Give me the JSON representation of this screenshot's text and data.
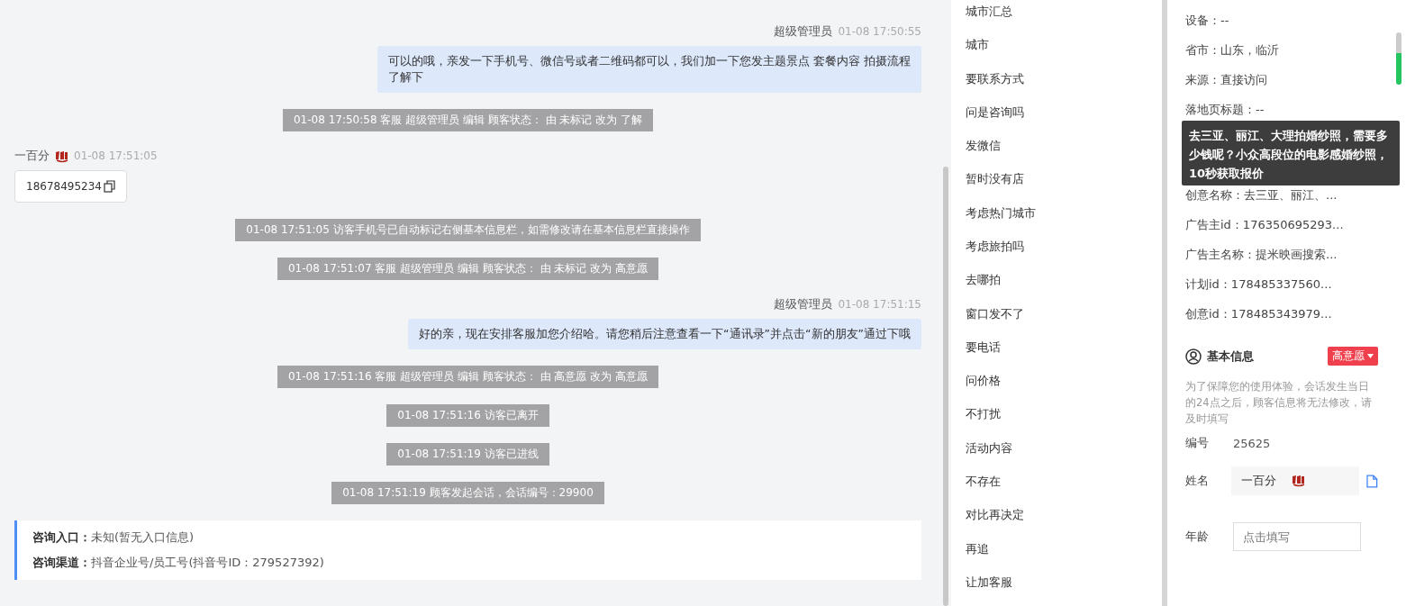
{
  "chat": {
    "messages": [
      {
        "kind": "agent",
        "name": "超级管理员",
        "time": "01-08 17:50:55",
        "text": "可以的哦，亲发一下手机号、微信号或者二维码都可以，我们加一下您发主题景点 套餐内容 拍摄流程了解下"
      },
      {
        "kind": "system",
        "text": "01-08 17:50:58 客服 超级管理员 编辑 顾客状态： 由 未标记 改为 了解"
      },
      {
        "kind": "visitor",
        "name": "一百分",
        "time": "01-08 17:51:05",
        "text": "18678495234"
      },
      {
        "kind": "system",
        "text": "01-08 17:51:05 访客手机号已自动标记右侧基本信息栏，如需修改请在基本信息栏直接操作"
      },
      {
        "kind": "system",
        "text": "01-08 17:51:07 客服 超级管理员 编辑 顾客状态： 由 未标记 改为 高意愿"
      },
      {
        "kind": "agent",
        "name": "超级管理员",
        "time": "01-08 17:51:15",
        "text": "好的亲，现在安排客服加您介绍哈。请您稍后注意查看一下“通讯录”并点击“新的朋友”通过下哦"
      },
      {
        "kind": "system",
        "text": "01-08 17:51:16 客服 超级管理员 编辑 顾客状态： 由 高意愿 改为 高意愿"
      },
      {
        "kind": "system",
        "text": "01-08 17:51:16 访客已离开"
      },
      {
        "kind": "system",
        "text": "01-08 17:51:19 访客已进线"
      },
      {
        "kind": "system",
        "text": "01-08 17:51:19 顾客发起会话，会话编号：29900"
      },
      {
        "kind": "entry",
        "lines": [
          {
            "label": "咨询入口：",
            "value": "未知(暂无入口信息)"
          },
          {
            "label": "咨询渠道：",
            "value": "抖音企业号/员工号(抖音号ID：279527392)"
          }
        ]
      }
    ]
  },
  "tags": {
    "items": [
      "城市汇总",
      "城市",
      "要联系方式",
      "问是咨询吗",
      "发微信",
      "暂时没有店",
      "考虑热门城市",
      "考虑旅拍吗",
      "去哪拍",
      "窗口发不了",
      "要电话",
      "问价格",
      "不打扰",
      "活动内容",
      "不存在",
      "对比再决定",
      "再追",
      "让加客服"
    ]
  },
  "details": {
    "rows": [
      {
        "kind": "text",
        "text": "设备：--"
      },
      {
        "kind": "text",
        "text": "省市：山东，临沂"
      },
      {
        "kind": "text",
        "text": "来源：直接访问"
      },
      {
        "kind": "text",
        "text": "落地页标题：--"
      },
      {
        "kind": "tooltip",
        "text": "去三亚、丽江、大理拍婚纱照，需要多少钱呢？小众高段位的电影感婚纱照，10秒获取报价"
      },
      {
        "kind": "text",
        "text": "创意名称：去三亚、丽江、..."
      },
      {
        "kind": "text",
        "text": "广告主id：176350695293..."
      },
      {
        "kind": "text",
        "text": "广告主名称：提米映画搜索..."
      },
      {
        "kind": "text",
        "text": "计划id：178485337560..."
      },
      {
        "kind": "text",
        "text": "创意id：178485343979..."
      }
    ]
  },
  "basic_info": {
    "title": "基本信息",
    "status": "高意愿",
    "note": "为了保障您的使用体验，会话发生当日的24点之后，顾客信息将无法修改，请及时填写",
    "fields": [
      {
        "kind": "text",
        "label": "编号",
        "value": "25625"
      },
      {
        "kind": "input",
        "label": "姓名",
        "value": "一百分"
      },
      {
        "kind": "input",
        "label": "年龄",
        "placeholder": "点击填写"
      }
    ]
  }
}
